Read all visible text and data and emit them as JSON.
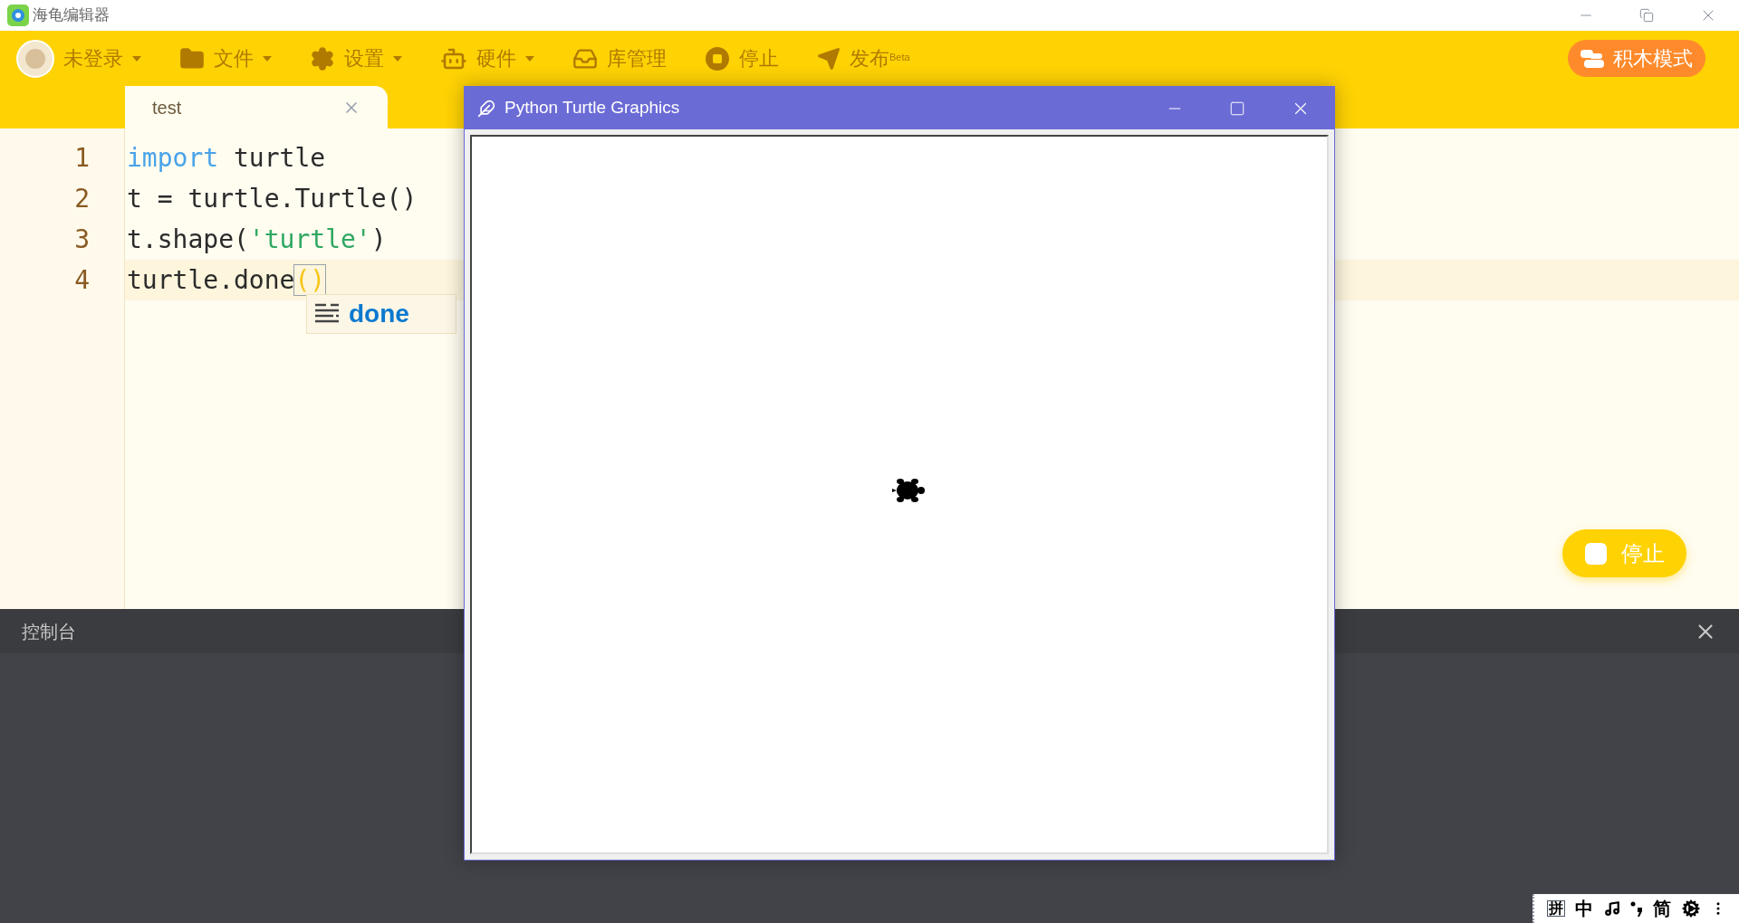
{
  "app_title": "海龟编辑器",
  "menu": [
    {
      "label": "未登录",
      "kind": "user",
      "dropdown": true
    },
    {
      "label": "文件",
      "kind": "folder",
      "dropdown": true
    },
    {
      "label": "设置",
      "kind": "gear",
      "dropdown": true
    },
    {
      "label": "硬件",
      "kind": "robot",
      "dropdown": true
    },
    {
      "label": "库管理",
      "kind": "inbox",
      "dropdown": false
    },
    {
      "label": "停止",
      "kind": "stop",
      "dropdown": false
    },
    {
      "label": "发布$^{Beta}$",
      "kind": "send",
      "dropdown": false
    }
  ],
  "mode_button": "积木模式",
  "tabs": [
    {
      "label": "test",
      "selected": true
    }
  ],
  "editor": {
    "lines": [
      {
        "number": "1",
        "current": false,
        "tokens": [
          {
            "text": "import",
            "kind": "keyword"
          },
          {
            "text": " turtle",
            "kind": "plain"
          }
        ]
      },
      {
        "number": "2",
        "current": false,
        "tokens": [
          {
            "text": "t = turtle.Turtle()",
            "kind": "plain"
          }
        ]
      },
      {
        "number": "3",
        "current": false,
        "tokens": [
          {
            "text": "t.shape(",
            "kind": "plain"
          },
          {
            "text": "'turtle'",
            "kind": "string"
          },
          {
            "text": ")",
            "kind": "plain"
          }
        ]
      },
      {
        "number": "4",
        "current": true,
        "tokens": [
          {
            "text": "turtle.done",
            "kind": "plain"
          },
          {
            "text": "()",
            "kind": "match"
          }
        ]
      }
    ]
  },
  "autocomplete": {
    "items": [
      {
        "label": "done"
      }
    ]
  },
  "turtle_window": {
    "title": "Python Turtle Graphics"
  },
  "run_button": "停止",
  "console": {
    "title": "控制台"
  },
  "ime_bar": {
    "items": [
      {
        "kind": "boxed",
        "label": "拼"
      },
      {
        "kind": "text",
        "label": "中"
      },
      {
        "kind": "note"
      },
      {
        "kind": "punct"
      },
      {
        "kind": "text",
        "label": "简"
      },
      {
        "kind": "gear"
      },
      {
        "kind": "more"
      }
    ]
  }
}
